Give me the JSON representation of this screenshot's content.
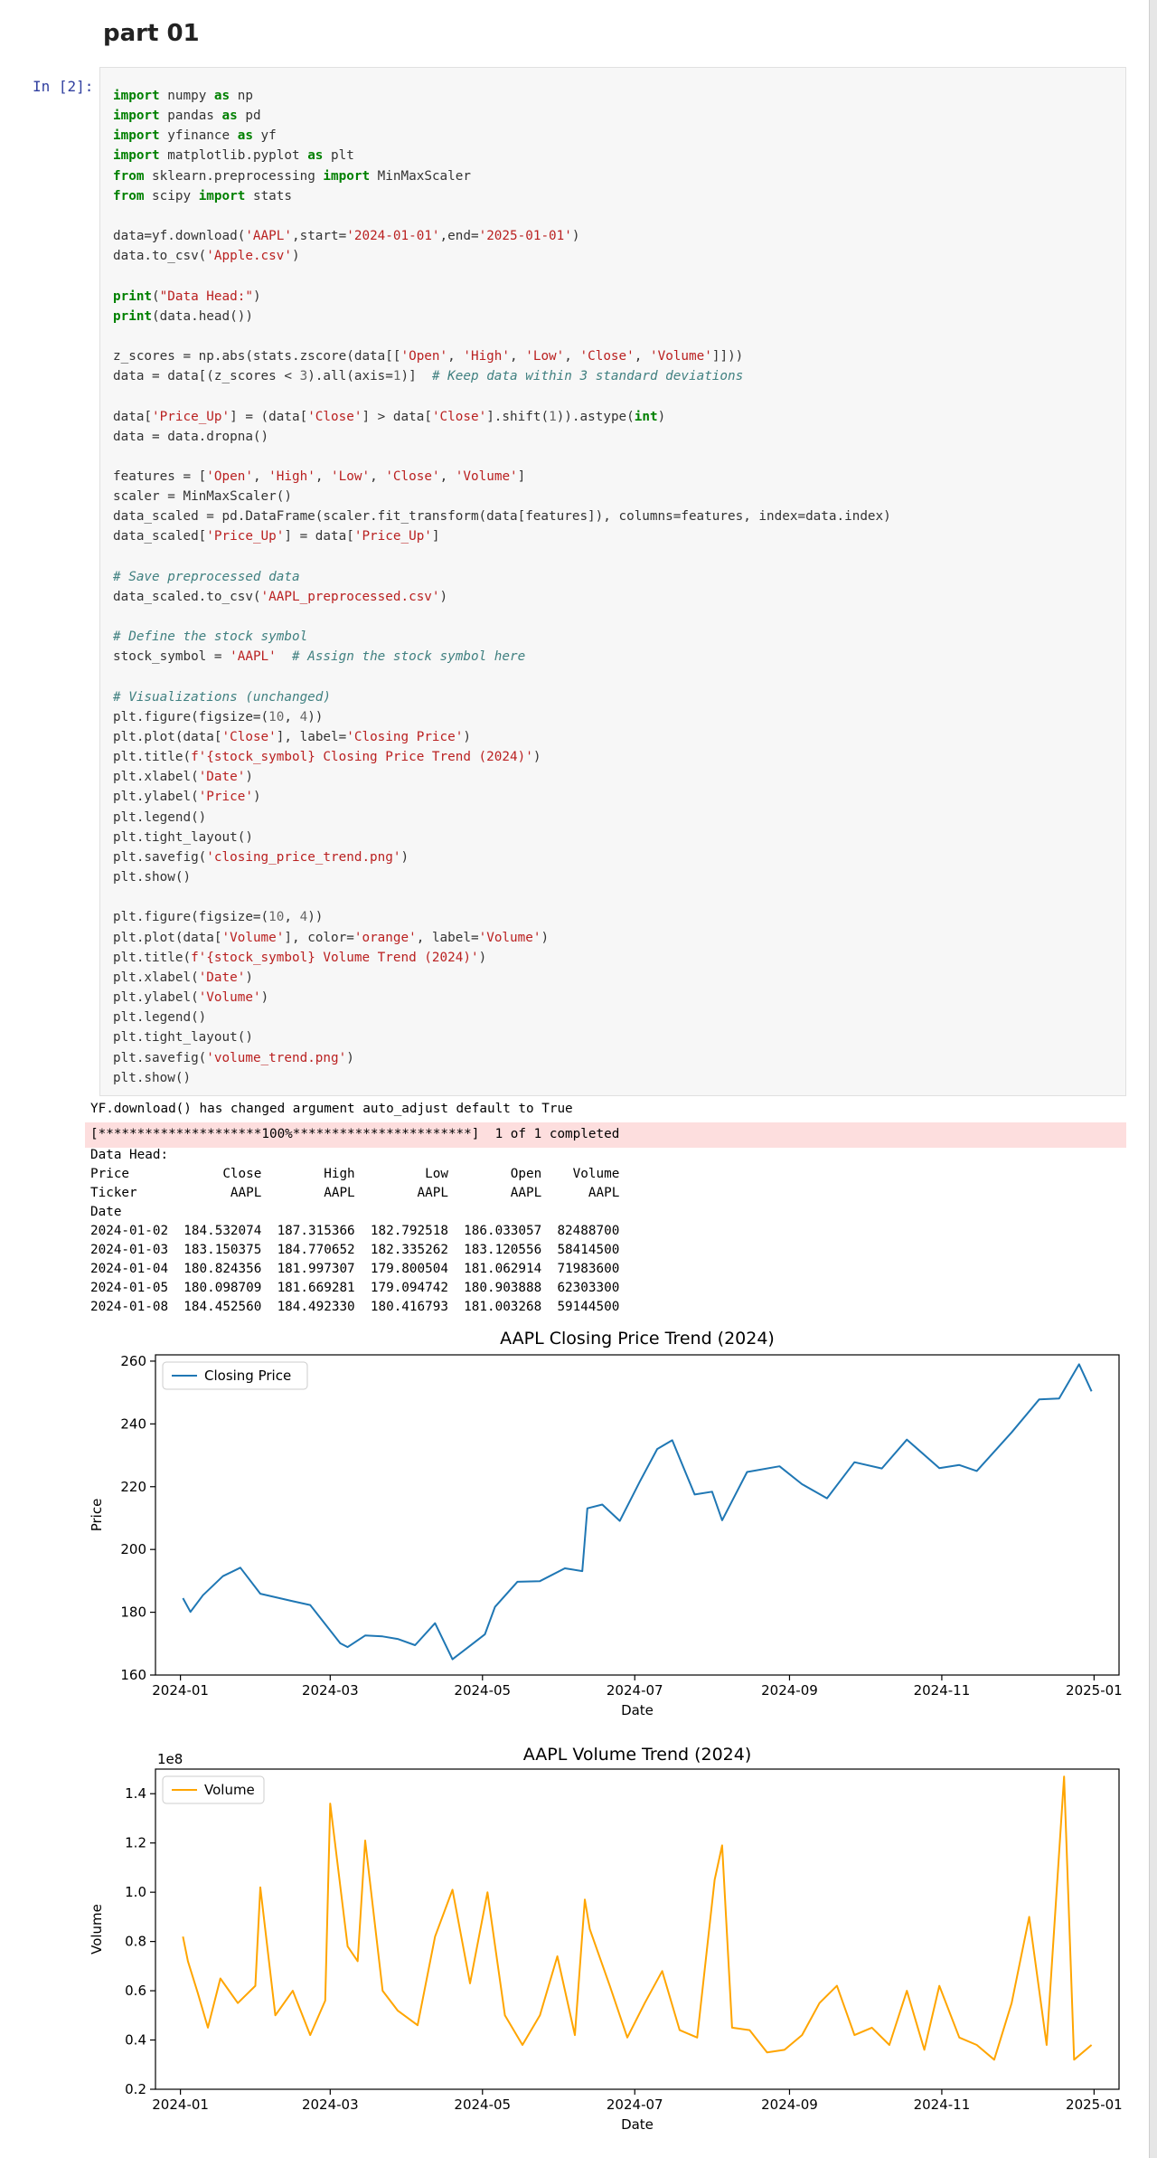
{
  "markdown": {
    "heading": "part 01"
  },
  "cell": {
    "prompt": "In [2]:"
  },
  "code_lines": [
    [
      [
        "kw",
        "import"
      ],
      [
        "t",
        " numpy "
      ],
      [
        "kw",
        "as"
      ],
      [
        "t",
        " np"
      ]
    ],
    [
      [
        "kw",
        "import"
      ],
      [
        "t",
        " pandas "
      ],
      [
        "kw",
        "as"
      ],
      [
        "t",
        " pd"
      ]
    ],
    [
      [
        "kw",
        "import"
      ],
      [
        "t",
        " yfinance "
      ],
      [
        "kw",
        "as"
      ],
      [
        "t",
        " yf"
      ]
    ],
    [
      [
        "kw",
        "import"
      ],
      [
        "t",
        " matplotlib.pyplot "
      ],
      [
        "kw",
        "as"
      ],
      [
        "t",
        " plt"
      ]
    ],
    [
      [
        "kw",
        "from"
      ],
      [
        "t",
        " sklearn.preprocessing "
      ],
      [
        "kw",
        "import"
      ],
      [
        "t",
        " MinMaxScaler"
      ]
    ],
    [
      [
        "kw",
        "from"
      ],
      [
        "t",
        " scipy "
      ],
      [
        "kw",
        "import"
      ],
      [
        "t",
        " stats"
      ]
    ],
    [],
    [
      [
        "t",
        "data=yf.download("
      ],
      [
        "str",
        "'AAPL'"
      ],
      [
        "t",
        ",start="
      ],
      [
        "str",
        "'2024-01-01'"
      ],
      [
        "t",
        ",end="
      ],
      [
        "str",
        "'2025-01-01'"
      ],
      [
        "t",
        ")"
      ]
    ],
    [
      [
        "t",
        "data.to_csv("
      ],
      [
        "str",
        "'Apple.csv'"
      ],
      [
        "t",
        ")"
      ]
    ],
    [],
    [
      [
        "kw",
        "print"
      ],
      [
        "t",
        "("
      ],
      [
        "str",
        "\"Data Head:\""
      ],
      [
        "t",
        ")"
      ]
    ],
    [
      [
        "kw",
        "print"
      ],
      [
        "t",
        "(data.head())"
      ]
    ],
    [],
    [
      [
        "t",
        "z_scores = np.abs(stats.zscore(data[["
      ],
      [
        "str",
        "'Open'"
      ],
      [
        "t",
        ", "
      ],
      [
        "str",
        "'High'"
      ],
      [
        "t",
        ", "
      ],
      [
        "str",
        "'Low'"
      ],
      [
        "t",
        ", "
      ],
      [
        "str",
        "'Close'"
      ],
      [
        "t",
        ", "
      ],
      [
        "str",
        "'Volume'"
      ],
      [
        "t",
        "]]))"
      ]
    ],
    [
      [
        "t",
        "data = data[(z_scores < "
      ],
      [
        "num",
        "3"
      ],
      [
        "t",
        ").all(axis="
      ],
      [
        "num",
        "1"
      ],
      [
        "t",
        ")]  "
      ],
      [
        "cm",
        "# Keep data within 3 standard deviations"
      ]
    ],
    [],
    [
      [
        "t",
        "data["
      ],
      [
        "str",
        "'Price_Up'"
      ],
      [
        "t",
        "] = (data["
      ],
      [
        "str",
        "'Close'"
      ],
      [
        "t",
        "] > data["
      ],
      [
        "str",
        "'Close'"
      ],
      [
        "t",
        "].shift("
      ],
      [
        "num",
        "1"
      ],
      [
        "t",
        ")).astype("
      ],
      [
        "kw",
        "int"
      ],
      [
        "t",
        ")"
      ]
    ],
    [
      [
        "t",
        "data = data.dropna()"
      ]
    ],
    [],
    [
      [
        "t",
        "features = ["
      ],
      [
        "str",
        "'Open'"
      ],
      [
        "t",
        ", "
      ],
      [
        "str",
        "'High'"
      ],
      [
        "t",
        ", "
      ],
      [
        "str",
        "'Low'"
      ],
      [
        "t",
        ", "
      ],
      [
        "str",
        "'Close'"
      ],
      [
        "t",
        ", "
      ],
      [
        "str",
        "'Volume'"
      ],
      [
        "t",
        "]"
      ]
    ],
    [
      [
        "t",
        "scaler = MinMaxScaler()"
      ]
    ],
    [
      [
        "t",
        "data_scaled = pd.DataFrame(scaler.fit_transform(data[features]), columns=features, index=data.index)"
      ]
    ],
    [
      [
        "t",
        "data_scaled["
      ],
      [
        "str",
        "'Price_Up'"
      ],
      [
        "t",
        "] = data["
      ],
      [
        "str",
        "'Price_Up'"
      ],
      [
        "t",
        "]"
      ]
    ],
    [],
    [
      [
        "cm",
        "# Save preprocessed data"
      ]
    ],
    [
      [
        "t",
        "data_scaled.to_csv("
      ],
      [
        "str",
        "'AAPL_preprocessed.csv'"
      ],
      [
        "t",
        ")"
      ]
    ],
    [],
    [
      [
        "cm",
        "# Define the stock symbol"
      ]
    ],
    [
      [
        "t",
        "stock_symbol = "
      ],
      [
        "str",
        "'AAPL'"
      ],
      [
        "t",
        "  "
      ],
      [
        "cm",
        "# Assign the stock symbol here"
      ]
    ],
    [],
    [
      [
        "cm",
        "# Visualizations (unchanged)"
      ]
    ],
    [
      [
        "t",
        "plt.figure(figsize=("
      ],
      [
        "num",
        "10"
      ],
      [
        "t",
        ", "
      ],
      [
        "num",
        "4"
      ],
      [
        "t",
        "))"
      ]
    ],
    [
      [
        "t",
        "plt.plot(data["
      ],
      [
        "str",
        "'Close'"
      ],
      [
        "t",
        "], label="
      ],
      [
        "str",
        "'Closing Price'"
      ],
      [
        "t",
        ")"
      ]
    ],
    [
      [
        "t",
        "plt.title("
      ],
      [
        "str",
        "f'{stock_symbol} Closing Price Trend (2024)'"
      ],
      [
        "t",
        ")"
      ]
    ],
    [
      [
        "t",
        "plt.xlabel("
      ],
      [
        "str",
        "'Date'"
      ],
      [
        "t",
        ")"
      ]
    ],
    [
      [
        "t",
        "plt.ylabel("
      ],
      [
        "str",
        "'Price'"
      ],
      [
        "t",
        ")"
      ]
    ],
    [
      [
        "t",
        "plt.legend()"
      ]
    ],
    [
      [
        "t",
        "plt.tight_layout()"
      ]
    ],
    [
      [
        "t",
        "plt.savefig("
      ],
      [
        "str",
        "'closing_price_trend.png'"
      ],
      [
        "t",
        ")"
      ]
    ],
    [
      [
        "t",
        "plt.show()"
      ]
    ],
    [],
    [
      [
        "t",
        "plt.figure(figsize=("
      ],
      [
        "num",
        "10"
      ],
      [
        "t",
        ", "
      ],
      [
        "num",
        "4"
      ],
      [
        "t",
        "))"
      ]
    ],
    [
      [
        "t",
        "plt.plot(data["
      ],
      [
        "str",
        "'Volume'"
      ],
      [
        "t",
        "], color="
      ],
      [
        "str",
        "'orange'"
      ],
      [
        "t",
        ", label="
      ],
      [
        "str",
        "'Volume'"
      ],
      [
        "t",
        ")"
      ]
    ],
    [
      [
        "t",
        "plt.title("
      ],
      [
        "str",
        "f'{stock_symbol} Volume Trend (2024)'"
      ],
      [
        "t",
        ")"
      ]
    ],
    [
      [
        "t",
        "plt.xlabel("
      ],
      [
        "str",
        "'Date'"
      ],
      [
        "t",
        ")"
      ]
    ],
    [
      [
        "t",
        "plt.ylabel("
      ],
      [
        "str",
        "'Volume'"
      ],
      [
        "t",
        ")"
      ]
    ],
    [
      [
        "t",
        "plt.legend()"
      ]
    ],
    [
      [
        "t",
        "plt.tight_layout()"
      ]
    ],
    [
      [
        "t",
        "plt.savefig("
      ],
      [
        "str",
        "'volume_trend.png'"
      ],
      [
        "t",
        ")"
      ]
    ],
    [
      [
        "t",
        "plt.show()"
      ]
    ]
  ],
  "output": {
    "warning": "YF.download() has changed argument auto_adjust default to True",
    "progress": "[*********************100%***********************]  1 of 1 completed",
    "table": [
      "Data Head:",
      "Price            Close        High         Low        Open    Volume",
      "Ticker            AAPL        AAPL        AAPL        AAPL      AAPL",
      "Date",
      "2024-01-02  184.532074  187.315366  182.792518  186.033057  82488700",
      "2024-01-03  183.150375  184.770652  182.335262  183.120556  58414500",
      "2024-01-04  180.824356  181.997307  179.800504  181.062914  71983600",
      "2024-01-05  180.098709  181.669281  179.094742  180.903888  62303300",
      "2024-01-08  184.452560  184.492330  180.416793  181.003268  59144500"
    ]
  },
  "chart_data": [
    {
      "type": "line",
      "title": "AAPL Closing Price Trend (2024)",
      "xlabel": "Date",
      "ylabel": "Price",
      "legend": "top-left",
      "color": "#1f77b4",
      "xticks": [
        "2024-01",
        "2024-03",
        "2024-05",
        "2024-07",
        "2024-09",
        "2024-11",
        "2025-01"
      ],
      "yticks": [
        "160",
        "180",
        "200",
        "220",
        "240",
        "260"
      ],
      "ylim": [
        160,
        262
      ],
      "series": [
        {
          "name": "Closing Price",
          "x": [
            "2024-01-02",
            "2024-01-05",
            "2024-01-10",
            "2024-01-18",
            "2024-01-25",
            "2024-02-02",
            "2024-02-15",
            "2024-02-22",
            "2024-03-05",
            "2024-03-08",
            "2024-03-15",
            "2024-03-22",
            "2024-03-28",
            "2024-04-04",
            "2024-04-12",
            "2024-04-19",
            "2024-04-26",
            "2024-05-02",
            "2024-05-06",
            "2024-05-15",
            "2024-05-24",
            "2024-06-03",
            "2024-06-10",
            "2024-06-12",
            "2024-06-18",
            "2024-06-25",
            "2024-07-03",
            "2024-07-10",
            "2024-07-16",
            "2024-07-25",
            "2024-08-01",
            "2024-08-05",
            "2024-08-15",
            "2024-08-28",
            "2024-09-06",
            "2024-09-16",
            "2024-09-27",
            "2024-10-08",
            "2024-10-18",
            "2024-10-31",
            "2024-11-08",
            "2024-11-15",
            "2024-11-29",
            "2024-12-10",
            "2024-12-18",
            "2024-12-26",
            "2024-12-31"
          ],
          "y": [
            184.5,
            180.1,
            185.4,
            191.5,
            194.2,
            185.9,
            183.5,
            182.3,
            170.1,
            168.9,
            172.6,
            172.3,
            171.5,
            169.5,
            176.5,
            165.0,
            169.3,
            173.0,
            181.7,
            189.7,
            189.9,
            194.0,
            193.1,
            213.1,
            214.3,
            209.1,
            221.6,
            232.0,
            234.8,
            217.5,
            218.4,
            209.3,
            224.7,
            226.5,
            220.8,
            216.3,
            227.8,
            225.8,
            235.0,
            225.9,
            226.9,
            225.0,
            237.3,
            247.8,
            248.1,
            259.0,
            250.4
          ]
        }
      ]
    },
    {
      "type": "line",
      "title": "AAPL Volume Trend (2024)",
      "xlabel": "Date",
      "ylabel": "Volume",
      "legend": "top-left",
      "color": "#ffa500",
      "scale_label": "1e8",
      "xticks": [
        "2024-01",
        "2024-03",
        "2024-05",
        "2024-07",
        "2024-09",
        "2024-11",
        "2025-01"
      ],
      "yticks": [
        "0.2",
        "0.4",
        "0.6",
        "0.8",
        "1.0",
        "1.2",
        "1.4"
      ],
      "ylim": [
        0.2,
        1.5
      ],
      "series": [
        {
          "name": "Volume",
          "x": [
            "2024-01-02",
            "2024-01-04",
            "2024-01-08",
            "2024-01-12",
            "2024-01-17",
            "2024-01-24",
            "2024-01-31",
            "2024-02-02",
            "2024-02-08",
            "2024-02-15",
            "2024-02-22",
            "2024-02-28",
            "2024-03-01",
            "2024-03-08",
            "2024-03-12",
            "2024-03-15",
            "2024-03-22",
            "2024-03-28",
            "2024-04-05",
            "2024-04-12",
            "2024-04-19",
            "2024-04-26",
            "2024-05-03",
            "2024-05-10",
            "2024-05-17",
            "2024-05-24",
            "2024-05-31",
            "2024-06-07",
            "2024-06-11",
            "2024-06-13",
            "2024-06-21",
            "2024-06-28",
            "2024-07-05",
            "2024-07-12",
            "2024-07-19",
            "2024-07-26",
            "2024-08-02",
            "2024-08-05",
            "2024-08-09",
            "2024-08-16",
            "2024-08-23",
            "2024-08-30",
            "2024-09-06",
            "2024-09-13",
            "2024-09-20",
            "2024-09-27",
            "2024-10-04",
            "2024-10-11",
            "2024-10-18",
            "2024-10-25",
            "2024-10-31",
            "2024-11-08",
            "2024-11-15",
            "2024-11-22",
            "2024-11-29",
            "2024-12-06",
            "2024-12-13",
            "2024-12-20",
            "2024-12-24",
            "2024-12-31"
          ],
          "y": [
            0.82,
            0.72,
            0.59,
            0.45,
            0.65,
            0.55,
            0.62,
            1.02,
            0.5,
            0.6,
            0.42,
            0.56,
            1.36,
            0.78,
            0.72,
            1.21,
            0.6,
            0.52,
            0.46,
            0.82,
            1.01,
            0.63,
            1.0,
            0.5,
            0.38,
            0.5,
            0.74,
            0.42,
            0.97,
            0.85,
            0.62,
            0.41,
            0.55,
            0.68,
            0.44,
            0.41,
            1.05,
            1.19,
            0.45,
            0.44,
            0.35,
            0.36,
            0.42,
            0.55,
            0.62,
            0.42,
            0.45,
            0.38,
            0.6,
            0.36,
            0.62,
            0.41,
            0.38,
            0.32,
            0.55,
            0.9,
            0.38,
            1.47,
            0.32,
            0.38
          ]
        }
      ]
    }
  ]
}
